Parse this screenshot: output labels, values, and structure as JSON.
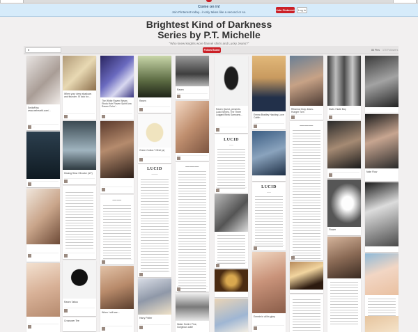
{
  "banner": {
    "title": "Come on in!",
    "subtitle": "Join Pinterest today...it only takes like a second or so.",
    "join_label": "Join Pinterest",
    "login_label": "Log in"
  },
  "board": {
    "title_line1": "Brightest Kind of Darkness",
    "title_line2": "Series by P.T. Michelle",
    "description": "\"Who knew knights wore flannel shirts and Lucky Jeans?\"",
    "follow_label": "Follow Board",
    "pins_label": "86 Pins",
    "followers_label": "170 Followers"
  },
  "pins": {
    "c1a": "Smile/Kiss www.weheartit.com/...",
    "c3a": "The White Raven Wears Ebola Hair 'Raven Spirit Ana Raven Color'...",
    "c4a": "Raven",
    "c5a": "Raven",
    "c6a": "Raven Quest, presents. Lucid Series, The Three Logged Birds Samoans...",
    "c7a": "Emma Bradley Hacking Love Caitlin",
    "c8a": "Rihanna Gray Jeans - Hunger Torn",
    "c10a": "Nate Flow",
    "c2a": "When your deep shadows and thunder. I'll look for...",
    "c2b": "Kissing Slow / Brooke (4/7)",
    "c2c": "Raven Tattoo",
    "c2d": "Crossover Tee",
    "c3c": "When I will see...",
    "c4b": "Green Cotton T-Shirt (a)",
    "c4d": "Harry Potter",
    "c5d": "Water Smile / Fine, Gorgeous cutie",
    "c8b": "Emmie in all its glory",
    "c9a": "Kiwis / Nate Boy",
    "c9b": "Flower"
  }
}
